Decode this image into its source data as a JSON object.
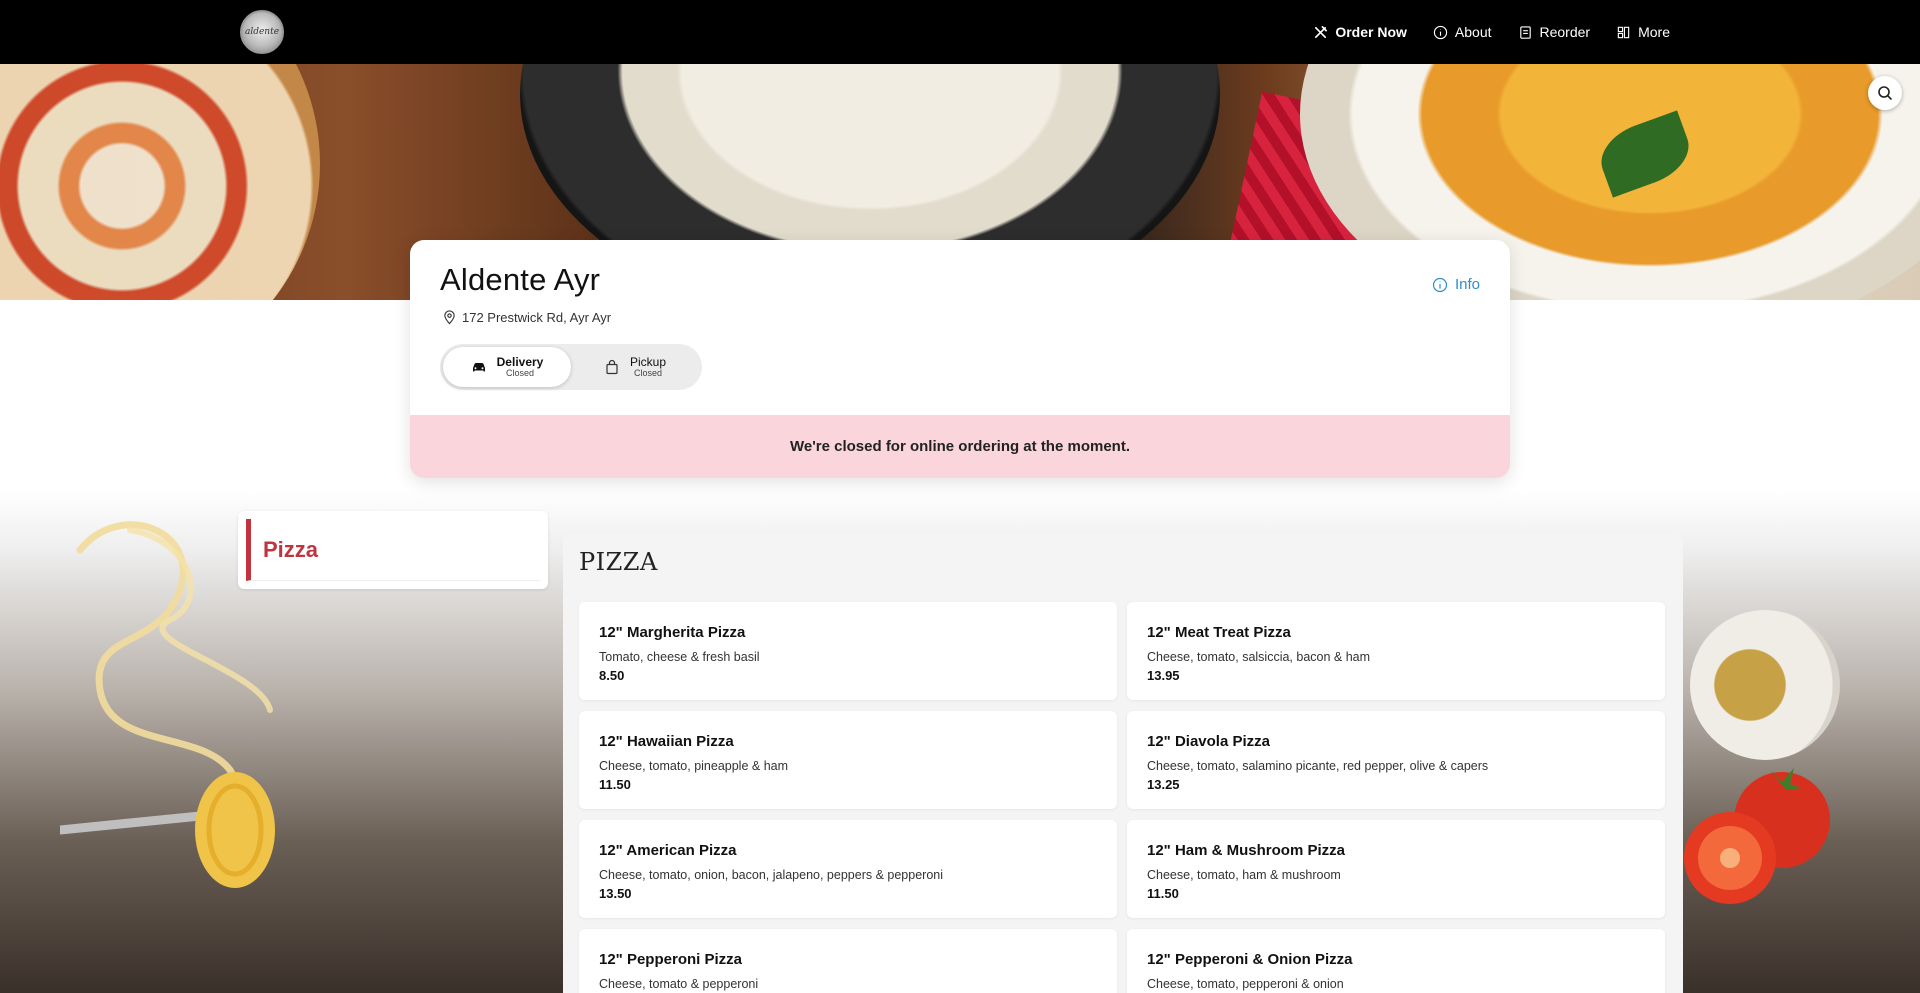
{
  "nav": {
    "logo_text": "aldente",
    "items": [
      {
        "label": "Order Now",
        "icon": "utensils-icon"
      },
      {
        "label": "About",
        "icon": "info-icon"
      },
      {
        "label": "Reorder",
        "icon": "receipt-icon"
      },
      {
        "label": "More",
        "icon": "grid-icon"
      }
    ]
  },
  "restaurant": {
    "name": "Aldente Ayr",
    "address": "172 Prestwick Rd, Ayr Ayr",
    "info_label": "Info",
    "closed_message": "We're closed for online ordering at the moment."
  },
  "order_modes": [
    {
      "label": "Delivery",
      "status": "Closed",
      "active": true
    },
    {
      "label": "Pickup",
      "status": "Closed",
      "active": false
    }
  ],
  "categories": [
    {
      "label": "Pizza",
      "active": true
    }
  ],
  "menu": {
    "section_title": "PIZZA",
    "items": [
      {
        "name": "12\" Margherita Pizza",
        "description": "Tomato, cheese & fresh basil",
        "price": "8.50"
      },
      {
        "name": "12\" Meat Treat Pizza",
        "description": "Cheese, tomato, salsiccia, bacon & ham",
        "price": "13.95"
      },
      {
        "name": "12\" Hawaiian Pizza",
        "description": "Cheese, tomato, pineapple & ham",
        "price": "11.50"
      },
      {
        "name": "12\" Diavola Pizza",
        "description": "Cheese, tomato, salamino picante, red pepper, olive & capers",
        "price": "13.25"
      },
      {
        "name": "12\" American Pizza",
        "description": "Cheese, tomato, onion, bacon, jalapeno, peppers & pepperoni",
        "price": "13.50"
      },
      {
        "name": "12\" Ham & Mushroom Pizza",
        "description": "Cheese, tomato, ham & mushroom",
        "price": "11.50"
      },
      {
        "name": "12\" Pepperoni Pizza",
        "description": "Cheese, tomato & pepperoni",
        "price": ""
      },
      {
        "name": "12\" Pepperoni & Onion Pizza",
        "description": "Cheese, tomato, pepperoni & onion",
        "price": ""
      }
    ]
  },
  "colors": {
    "accent": "#c0343f",
    "info_link": "#2d8ec9",
    "closed_banner": "#fad6dc",
    "nav_bg": "#000000"
  }
}
